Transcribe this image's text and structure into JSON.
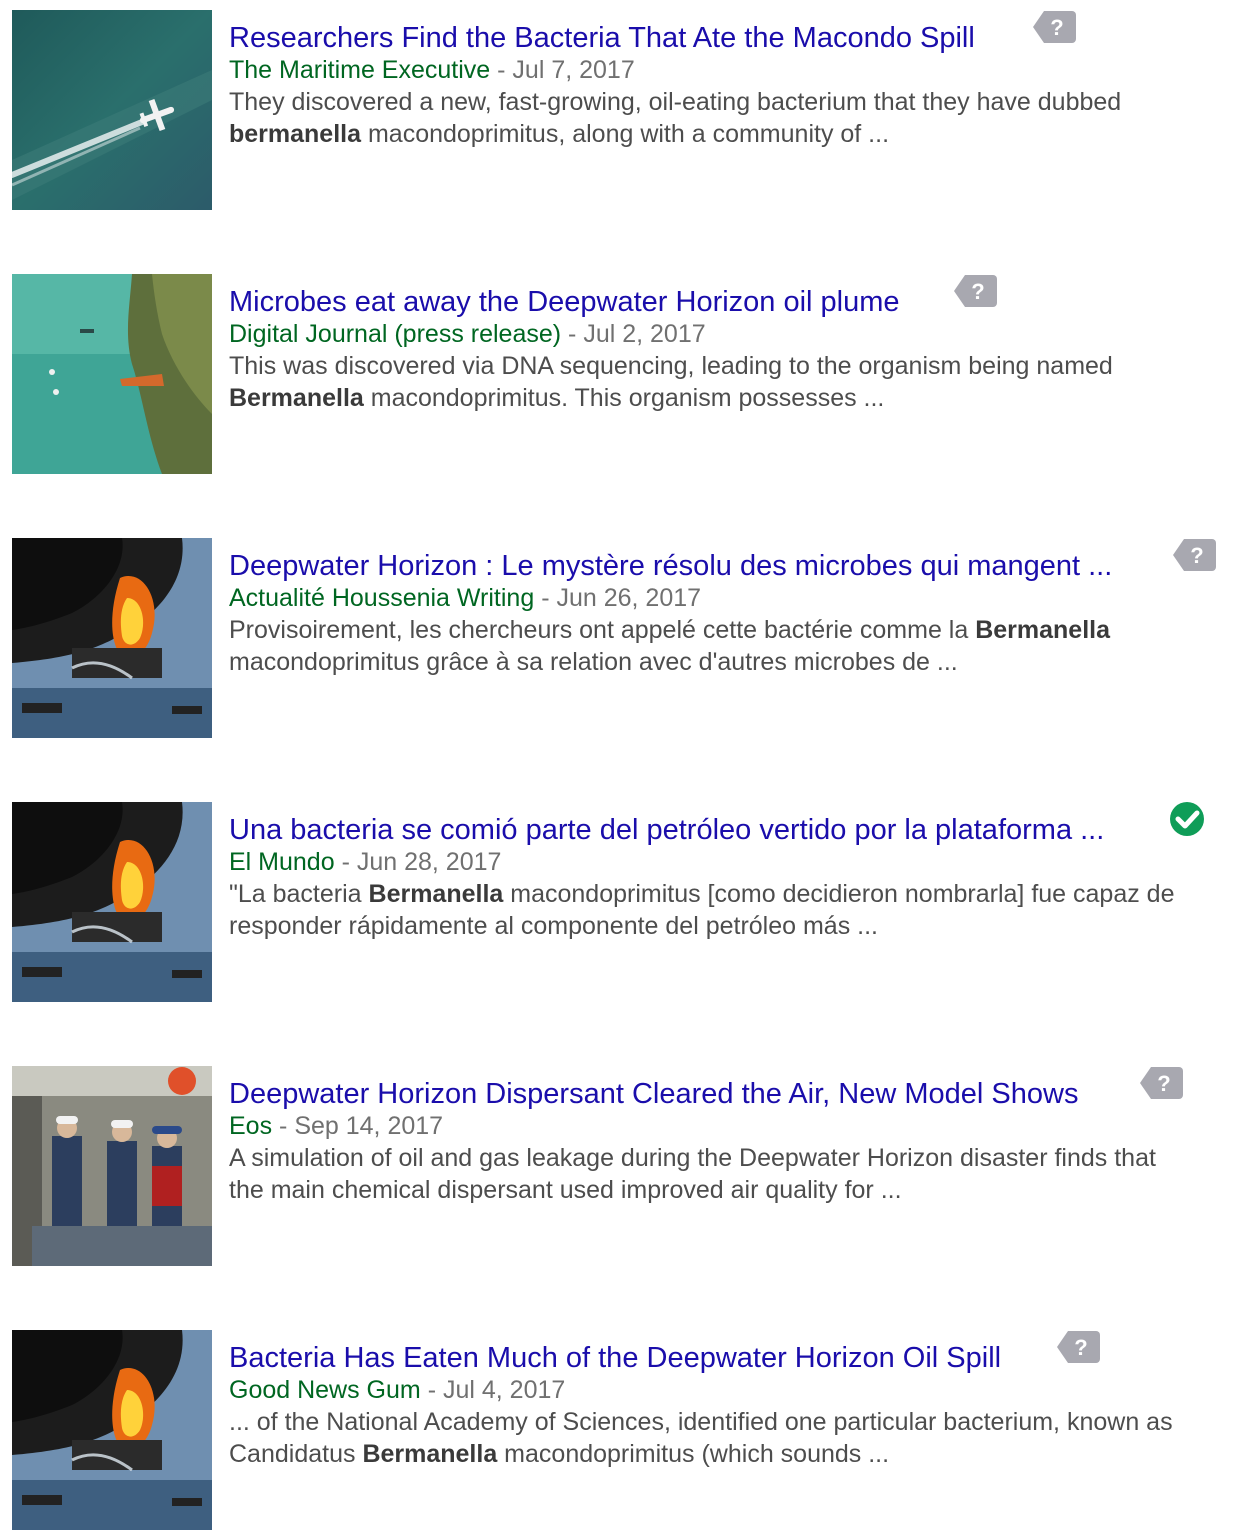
{
  "colors": {
    "title_link": "#1a0dab",
    "source": "#006621",
    "date": "#707070",
    "snippet": "#4d4d4d",
    "badge_unknown": "#a8a8b0",
    "badge_verified": "#0f9d58"
  },
  "results": [
    {
      "title": "Researchers Find the Bacteria That Ate the Macondo Spill",
      "source": "The Maritime Executive",
      "separator": " - ",
      "date": "Jul 7, 2017",
      "snippet": [
        [
          {
            "t": "They discovered a new, fast-growing, oil-eating bacterium that they have dubbed"
          }
        ],
        [
          {
            "t": "bermanella",
            "b": true
          },
          {
            "t": " macondoprimitus, along with a community of ..."
          }
        ]
      ],
      "badge": "question-icon",
      "thumbnail": "aerial-plane-over-oil-slick"
    },
    {
      "title": "Microbes eat away the Deepwater Horizon oil plume",
      "source": "Digital Journal (press release)",
      "separator": " - ",
      "date": "Jul 2, 2017",
      "snippet": [
        [
          {
            "t": "This was discovered via DNA sequencing, leading to the organism being named"
          }
        ],
        [
          {
            "t": "Bermanella",
            "b": true
          },
          {
            "t": " macondoprimitus. This organism possesses ..."
          }
        ]
      ],
      "badge": "question-icon",
      "thumbnail": "aerial-smoke-plume-over-sea"
    },
    {
      "title": "Deepwater Horizon : Le mystère résolu des microbes qui mangent ...",
      "source": "Actualité Houssenia Writing",
      "separator": " - ",
      "date": "Jun 26, 2017",
      "snippet": [
        [
          {
            "t": "Provisoirement, les chercheurs ont appelé cette bactérie comme la "
          },
          {
            "t": "Bermanella",
            "b": true
          }
        ],
        [
          {
            "t": "macondoprimitus grâce à sa relation avec d'autres microbes de ..."
          }
        ]
      ],
      "badge": "question-icon",
      "thumbnail": "burning-oil-rig"
    },
    {
      "title": "Una bacteria se comió parte del petróleo vertido por la plataforma ...",
      "source": "El Mundo",
      "separator": " - ",
      "date": "Jun 28, 2017",
      "snippet": [
        [
          {
            "t": "\"La bacteria "
          },
          {
            "t": "Bermanella",
            "b": true
          },
          {
            "t": " macondoprimitus [como decidieron nombrarla] fue capaz de"
          }
        ],
        [
          {
            "t": "responder rápidamente al componente del petróleo más ..."
          }
        ]
      ],
      "badge": "check-icon",
      "thumbnail": "burning-oil-rig"
    },
    {
      "title": "Deepwater Horizon Dispersant Cleared the Air, New Model Shows",
      "source": "Eos",
      "separator": " - ",
      "date": "Sep 14, 2017",
      "snippet": [
        [
          {
            "t": "A simulation of oil and gas leakage during the Deepwater Horizon disaster finds that"
          }
        ],
        [
          {
            "t": "the main chemical dispersant used improved air quality for ..."
          }
        ]
      ],
      "badge": "question-icon",
      "thumbnail": "workers-in-hardhats"
    },
    {
      "title": "Bacteria Has Eaten Much of the Deepwater Horizon Oil Spill",
      "source": "Good News Gum",
      "separator": " - ",
      "date": "Jul 4, 2017",
      "snippet": [
        [
          {
            "t": "... of the National Academy of Sciences, identified one particular bacterium, known as"
          }
        ],
        [
          {
            "t": "Candidatus "
          },
          {
            "t": "Bermanella",
            "b": true
          },
          {
            "t": " macondoprimitus (which sounds ..."
          }
        ]
      ],
      "badge": "question-icon",
      "thumbnail": "burning-oil-rig"
    }
  ]
}
